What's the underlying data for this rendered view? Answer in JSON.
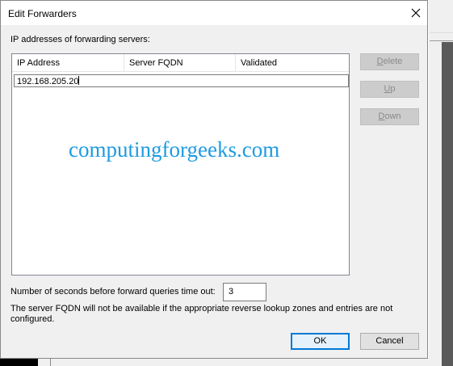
{
  "window": {
    "title": "Edit Forwarders"
  },
  "labels": {
    "ip_section": "IP addresses of forwarding servers:",
    "timeout": "Number of seconds before forward queries time out:",
    "note": "The server FQDN will not be available if the appropriate reverse lookup zones and entries are not configured."
  },
  "table": {
    "columns": [
      "IP Address",
      "Server FQDN",
      "Validated"
    ],
    "editing_value": "192.168.205.20"
  },
  "watermark": "computingforgeeks.com",
  "side_buttons": {
    "delete": "Delete",
    "up": "Up",
    "down": "Down"
  },
  "timeout_value": "3",
  "buttons": {
    "ok": "OK",
    "cancel": "Cancel"
  },
  "colors": {
    "accent": "#0078d7",
    "watermark": "#1e9be0"
  }
}
